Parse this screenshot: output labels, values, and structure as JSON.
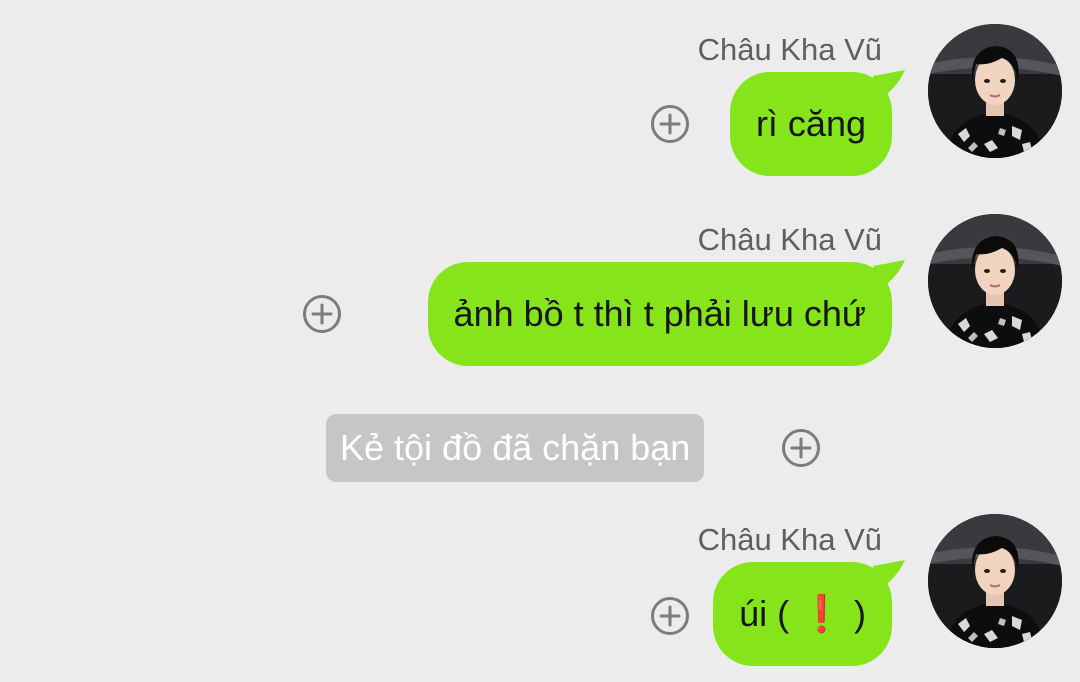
{
  "messages": [
    {
      "sender": "Châu Kha Vũ",
      "text": "rì căng"
    },
    {
      "sender": "Châu Kha Vũ",
      "text": "ảnh bồ t thì t phải lưu chứ"
    },
    {
      "text_before": "úi (",
      "emoji": "❗",
      "emoji_name": "red-exclamation-icon",
      "text_after": ")",
      "sender": "Châu Kha Vũ"
    }
  ],
  "system_message": {
    "text": "Kẻ tội đồ đã chặn bạn"
  },
  "colors": {
    "background": "#ececec",
    "bubble": "#86e51a",
    "system_bubble": "#c6c6c6",
    "sender_text": "#5f5f5f"
  },
  "icons": {
    "add_reaction": "circle-plus-icon"
  }
}
